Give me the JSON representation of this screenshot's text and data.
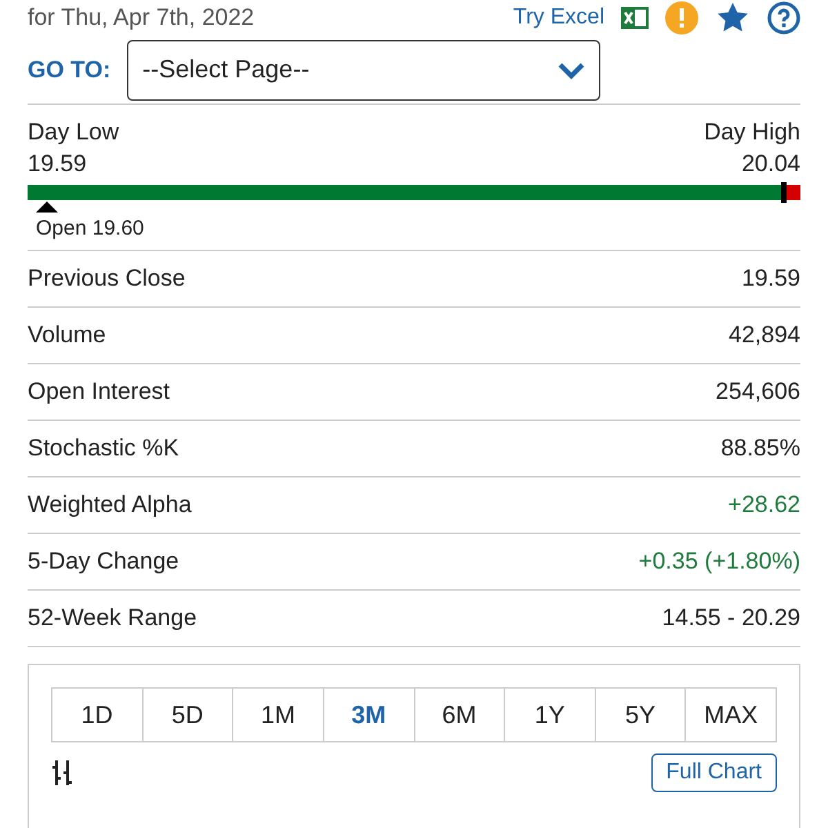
{
  "header": {
    "date": "for Thu, Apr 7th, 2022",
    "excel_link": "Try Excel"
  },
  "goto": {
    "label": "GO TO:",
    "placeholder": "--Select Page--"
  },
  "range": {
    "low_label": "Day Low",
    "low": "19.59",
    "high_label": "Day High",
    "high": "20.04",
    "level": 0.978,
    "open": {
      "level": 0.025,
      "text": "Open 19.60"
    }
  },
  "stats": [
    {
      "label": "Previous Close",
      "value": "19.59",
      "positive": false
    },
    {
      "label": "Volume",
      "value": "42,894",
      "positive": false
    },
    {
      "label": "Open Interest",
      "value": "254,606",
      "positive": false
    },
    {
      "label": "Stochastic %K",
      "value": "88.85%",
      "positive": false
    },
    {
      "label": "Weighted Alpha",
      "value": "+28.62",
      "positive": true
    },
    {
      "label": "5-Day Change",
      "value": "+0.35 (+1.80%)",
      "positive": true
    },
    {
      "label": "52-Week Range",
      "value": "14.55 - 20.29",
      "positive": false
    }
  ],
  "periods": [
    {
      "label": "1D",
      "selected": false
    },
    {
      "label": "5D",
      "selected": false
    },
    {
      "label": "1M",
      "selected": false
    },
    {
      "label": "3M",
      "selected": true
    },
    {
      "label": "6M",
      "selected": false
    },
    {
      "label": "1Y",
      "selected": false
    },
    {
      "label": "5Y",
      "selected": false
    },
    {
      "label": "MAX",
      "selected": false
    }
  ],
  "full_chart": "Full Chart"
}
